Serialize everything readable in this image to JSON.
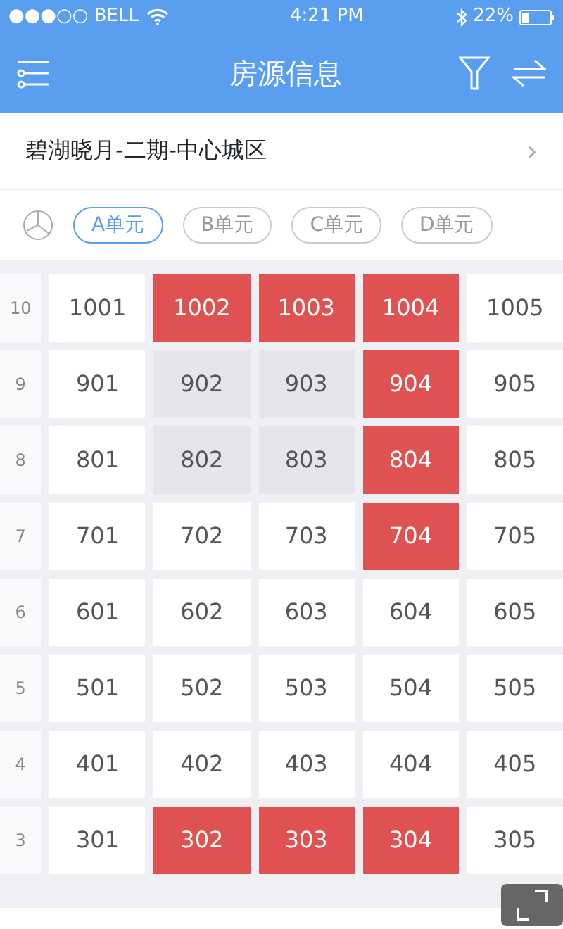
{
  "status_bar": {
    "carrier": "●●●○○ BELL",
    "time": "4:21 PM",
    "battery": "22%"
  },
  "nav": {
    "title": "房源信息"
  },
  "project": {
    "name": "碧湖晓月-二期-中心城区",
    "chevron": "›"
  },
  "unit_tabs": [
    {
      "label": "A单元",
      "selected": true
    },
    {
      "label": "B单元",
      "selected": false
    },
    {
      "label": "C单元",
      "selected": false
    },
    {
      "label": "D单元",
      "selected": false
    }
  ],
  "floors": [
    {
      "floor": "10",
      "rooms": [
        {
          "number": "1001",
          "kind": "available"
        },
        {
          "number": "1002",
          "kind": "sold"
        },
        {
          "number": "1003",
          "kind": "sold"
        },
        {
          "number": "1004",
          "kind": "sold"
        },
        {
          "number": "1005",
          "kind": "available"
        }
      ]
    },
    {
      "floor": "9",
      "rooms": [
        {
          "number": "901",
          "kind": "available"
        },
        {
          "number": "902",
          "kind": "reserved"
        },
        {
          "number": "903",
          "kind": "reserved"
        },
        {
          "number": "904",
          "kind": "sold"
        },
        {
          "number": "905",
          "kind": "available"
        }
      ]
    },
    {
      "floor": "8",
      "rooms": [
        {
          "number": "801",
          "kind": "available"
        },
        {
          "number": "802",
          "kind": "reserved"
        },
        {
          "number": "803",
          "kind": "reserved"
        },
        {
          "number": "804",
          "kind": "sold"
        },
        {
          "number": "805",
          "kind": "available"
        }
      ]
    },
    {
      "floor": "7",
      "rooms": [
        {
          "number": "701",
          "kind": "available"
        },
        {
          "number": "702",
          "kind": "available"
        },
        {
          "number": "703",
          "kind": "available"
        },
        {
          "number": "704",
          "kind": "sold"
        },
        {
          "number": "705",
          "kind": "available"
        }
      ]
    },
    {
      "floor": "6",
      "rooms": [
        {
          "number": "601",
          "kind": "available"
        },
        {
          "number": "602",
          "kind": "available"
        },
        {
          "number": "603",
          "kind": "available"
        },
        {
          "number": "604",
          "kind": "available"
        },
        {
          "number": "605",
          "kind": "available"
        }
      ]
    },
    {
      "floor": "5",
      "rooms": [
        {
          "number": "501",
          "kind": "available"
        },
        {
          "number": "502",
          "kind": "available"
        },
        {
          "number": "503",
          "kind": "available"
        },
        {
          "number": "504",
          "kind": "available"
        },
        {
          "number": "505",
          "kind": "available"
        }
      ]
    },
    {
      "floor": "4",
      "rooms": [
        {
          "number": "401",
          "kind": "available"
        },
        {
          "number": "402",
          "kind": "available"
        },
        {
          "number": "403",
          "kind": "available"
        },
        {
          "number": "404",
          "kind": "available"
        },
        {
          "number": "405",
          "kind": "available"
        }
      ]
    },
    {
      "floor": "3",
      "rooms": [
        {
          "number": "301",
          "kind": "available"
        },
        {
          "number": "302",
          "kind": "sold"
        },
        {
          "number": "303",
          "kind": "sold"
        },
        {
          "number": "304",
          "kind": "sold"
        },
        {
          "number": "305",
          "kind": "available"
        }
      ]
    }
  ]
}
